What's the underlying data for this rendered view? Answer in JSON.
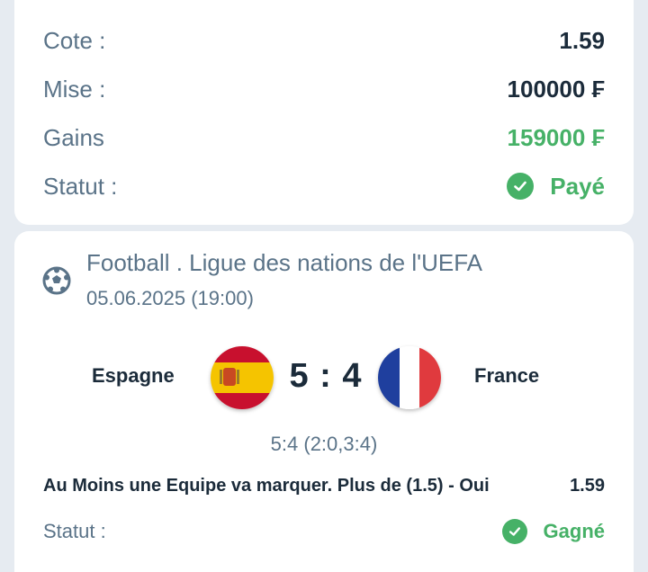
{
  "summary": {
    "rows": [
      {
        "label": "Cote :",
        "value": "1.59"
      },
      {
        "label": "Mise :",
        "value": "100000 ₣"
      },
      {
        "label": "Gains",
        "value": "159000 ₣"
      },
      {
        "label": "Statut :",
        "value": "Payé"
      }
    ]
  },
  "event": {
    "league": "Football . Ligue des nations de l'UEFA",
    "datetime": "05.06.2025 (19:00)",
    "home_team": "Espagne",
    "away_team": "France",
    "score": "5 : 4",
    "score_detail": "5:4 (2:0,3:4)",
    "bet_description": "Au Moins une Equipe va marquer. Plus de (1.5) - Oui",
    "bet_odds": "1.59",
    "status_label": "Statut :",
    "status_value": "Gagné"
  },
  "colors": {
    "background": "#e6ebf1",
    "card": "#ffffff",
    "label": "#5a7388",
    "value": "#1b2b3a",
    "success": "#46b167"
  },
  "icons": {
    "status_paid": "check-circle-icon",
    "status_won": "check-circle-icon",
    "sport": "soccer-ball-icon",
    "home_flag": "spain-flag-icon",
    "away_flag": "france-flag-icon"
  }
}
